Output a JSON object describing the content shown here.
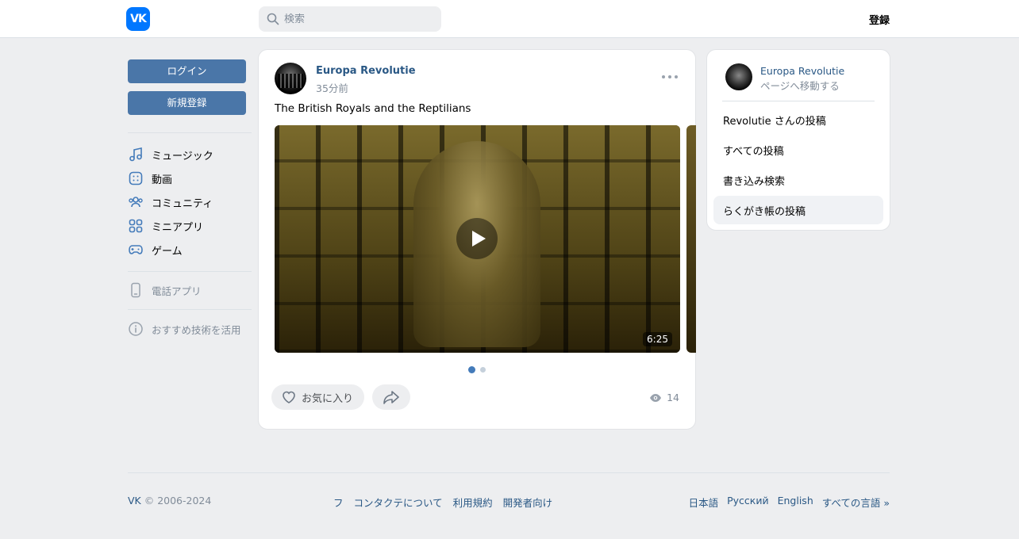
{
  "header": {
    "logo_text": "VK",
    "search_placeholder": "検索",
    "register_label": "登録"
  },
  "sidebar": {
    "login_label": "ログイン",
    "signup_label": "新規登録",
    "items": [
      {
        "label": "ミュージック",
        "icon": "music-icon"
      },
      {
        "label": "動画",
        "icon": "video-icon"
      },
      {
        "label": "コミュニティ",
        "icon": "community-icon"
      },
      {
        "label": "ミニアプリ",
        "icon": "mini-apps-icon"
      },
      {
        "label": "ゲーム",
        "icon": "gamepad-icon"
      }
    ],
    "phone_app_label": "電話アプリ",
    "recommend_label": "おすすめ技術を活用"
  },
  "post": {
    "author": "Europa Revolutie",
    "time": "35分前",
    "text": "The British Royals and the Reptilians",
    "video_duration": "6:25",
    "like_label": "お気に入り",
    "views": "14",
    "carousel_count": 2,
    "carousel_active": 1
  },
  "side_panel": {
    "name": "Europa Revolutie",
    "subtitle": "ページへ移動する",
    "links": [
      {
        "label": "Revolutie さんの投稿",
        "active": false
      },
      {
        "label": "すべての投稿",
        "active": false
      },
      {
        "label": "書き込み検索",
        "active": false
      },
      {
        "label": "らくがき帳の投稿",
        "active": true
      }
    ]
  },
  "footer": {
    "copyright_brand": "VK",
    "copyright_years": " © 2006-2024",
    "links": [
      "フ",
      "コンタクテについて",
      "利用規約",
      "開発者向け"
    ],
    "languages": [
      "日本語",
      "Русский",
      "English",
      "すべての言語 »"
    ]
  },
  "colors": {
    "brand": "#0077ff",
    "button": "#4a76a8",
    "link": "#2a5885",
    "muted": "#818c99",
    "background": "#edeef0"
  }
}
